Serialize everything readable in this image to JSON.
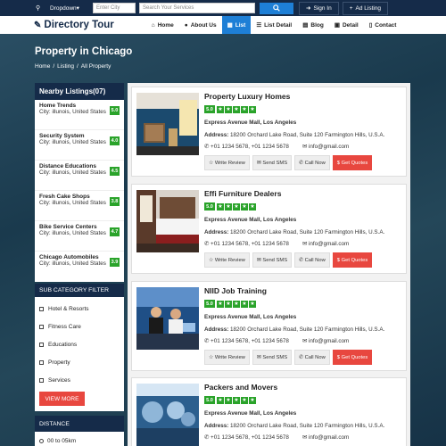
{
  "topbar": {
    "dropdown_label": "Dropdown▾",
    "city_placeholder": "Enter City",
    "search_placeholder": "Search Your Services",
    "sign_in": "Sign In",
    "add_listing": "Ad Listing"
  },
  "nav": {
    "logo": "Directory Tour",
    "items": [
      {
        "label": "Home",
        "icon": "home-icon"
      },
      {
        "label": "About Us",
        "icon": "user-icon"
      },
      {
        "label": "List",
        "icon": "grid-icon",
        "active": true
      },
      {
        "label": "List Detail",
        "icon": "list-icon"
      },
      {
        "label": "Blog",
        "icon": "book-icon"
      },
      {
        "label": "Detail",
        "icon": "file-icon"
      },
      {
        "label": "Contact",
        "icon": "contact-icon"
      }
    ]
  },
  "hero": {
    "title": "Property in Chicago",
    "crumbs": [
      "Home",
      "/",
      "Listing",
      "/",
      "All Property"
    ]
  },
  "sidebar": {
    "heading": "Nearby Listings(07)",
    "items": [
      {
        "title": "Home Trends",
        "city": "City: illunois, United States",
        "rating": "5.0"
      },
      {
        "title": "Security System",
        "city": "City: illunois, United States",
        "rating": "4.0"
      },
      {
        "title": "Distance Educations",
        "city": "City: illunois, United States",
        "rating": "4.5"
      },
      {
        "title": "Fresh Cake Shops",
        "city": "City: illunois, United States",
        "rating": "3.8"
      },
      {
        "title": "Bike Service Centers",
        "city": "City: illunois, United States",
        "rating": "4.7"
      },
      {
        "title": "Chicago Automobiles",
        "city": "City: illunois, United States",
        "rating": "3.9"
      }
    ],
    "sub_heading": "SUB CATEGORY FILTER",
    "categories": [
      "Hotel & Resorts",
      "Fitness Care",
      "Educations",
      "Property",
      "Services"
    ],
    "view_more": "VIEW MORE",
    "distance_heading": "DISTANCE",
    "distance_options": [
      "00 to 05km"
    ]
  },
  "listings": [
    {
      "name": "Property Luxury Homes",
      "rating": "5.0",
      "area": "Express Avenue Mall, Los Angeles",
      "address_label": "Address:",
      "address": "18200 Orchard Lake Road, Suite 120 Farmington Hills, U.S.A.",
      "phone": "+01 1234 5678, +01 1234 5678",
      "email": "info@gmail.com",
      "image_theme": "interior"
    },
    {
      "name": "Effi Furniture Dealers",
      "rating": "5.0",
      "area": "Express Avenue Mall, Los Angeles",
      "address_label": "Address:",
      "address": "18200 Orchard Lake Road, Suite 120 Farmington Hills, U.S.A.",
      "phone": "+01 1234 5678, +01 1234 5678",
      "email": "info@gmail.com",
      "image_theme": "bedroom"
    },
    {
      "name": "NIID Job Training",
      "rating": "5.0",
      "area": "Express Avenue Mall, Los Angeles",
      "address_label": "Address:",
      "address": "18200 Orchard Lake Road, Suite 120 Farmington Hills, U.S.A.",
      "phone": "+01 1234 5678, +01 1234 5678",
      "email": "info@gmail.com",
      "image_theme": "office"
    },
    {
      "name": "Packers and Movers",
      "rating": "5.0",
      "area": "Express Avenue Mall, Los Angeles",
      "address_label": "Address:",
      "address": "18200 Orchard Lake Road, Suite 120 Farmington Hills, U.S.A.",
      "phone": "+01 1234 5678, +01 1234 5678",
      "email": "info@gmail.com",
      "image_theme": "warehouse"
    }
  ],
  "card_buttons": {
    "review": "Write Review",
    "sms": "Send SMS",
    "call": "Call Now",
    "quote": "Get Quotes"
  },
  "colors": {
    "navy": "#152b49",
    "accent_blue": "#1e7fd6",
    "rating_green": "#2aa32a",
    "cta_red": "#e8473f"
  }
}
